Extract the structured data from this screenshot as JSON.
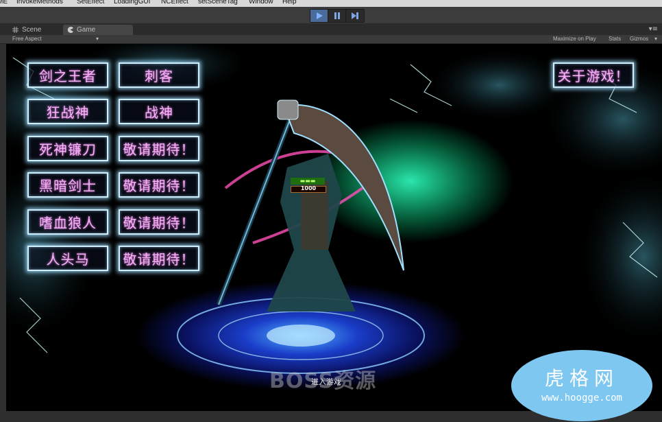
{
  "menubar": {
    "items": [
      "ME",
      "InvokeMethods",
      "SetEffect",
      "LoadingGUI",
      "NCEffect",
      "setSceneTag",
      "Window",
      "Help"
    ]
  },
  "toolbar": {
    "play_icon": "play-icon",
    "pause_icon": "pause-icon",
    "step_icon": "step-icon",
    "active_color": "#4a6a9a"
  },
  "tabs": {
    "scene_label": "Scene",
    "game_label": "Game"
  },
  "game_toolbar": {
    "aspect": "Free Aspect",
    "maximize": "Maximize on Play",
    "stats": "Stats",
    "gizmos": "Gizmos"
  },
  "game": {
    "heroes_left": [
      "剑之王者",
      "狂战神",
      "死神镰刀",
      "黑暗剑士",
      "嗜血狼人",
      "人头马"
    ],
    "heroes_right": [
      "刺客",
      "战神",
      "敬请期待！",
      "敬请期待！",
      "敬请期待！",
      "敬请期待！"
    ],
    "about_label": "关于游戏！",
    "enter_label": "进入游戏",
    "hp_value": "1000",
    "button_text_color": "#f6b4f6",
    "button_border_color": "#cfefff"
  },
  "watermark": {
    "boss": "BOSS资源",
    "site_name": "虎格网",
    "site_url": "www.hoogge.com",
    "logo_color": "#7ec7f1"
  }
}
